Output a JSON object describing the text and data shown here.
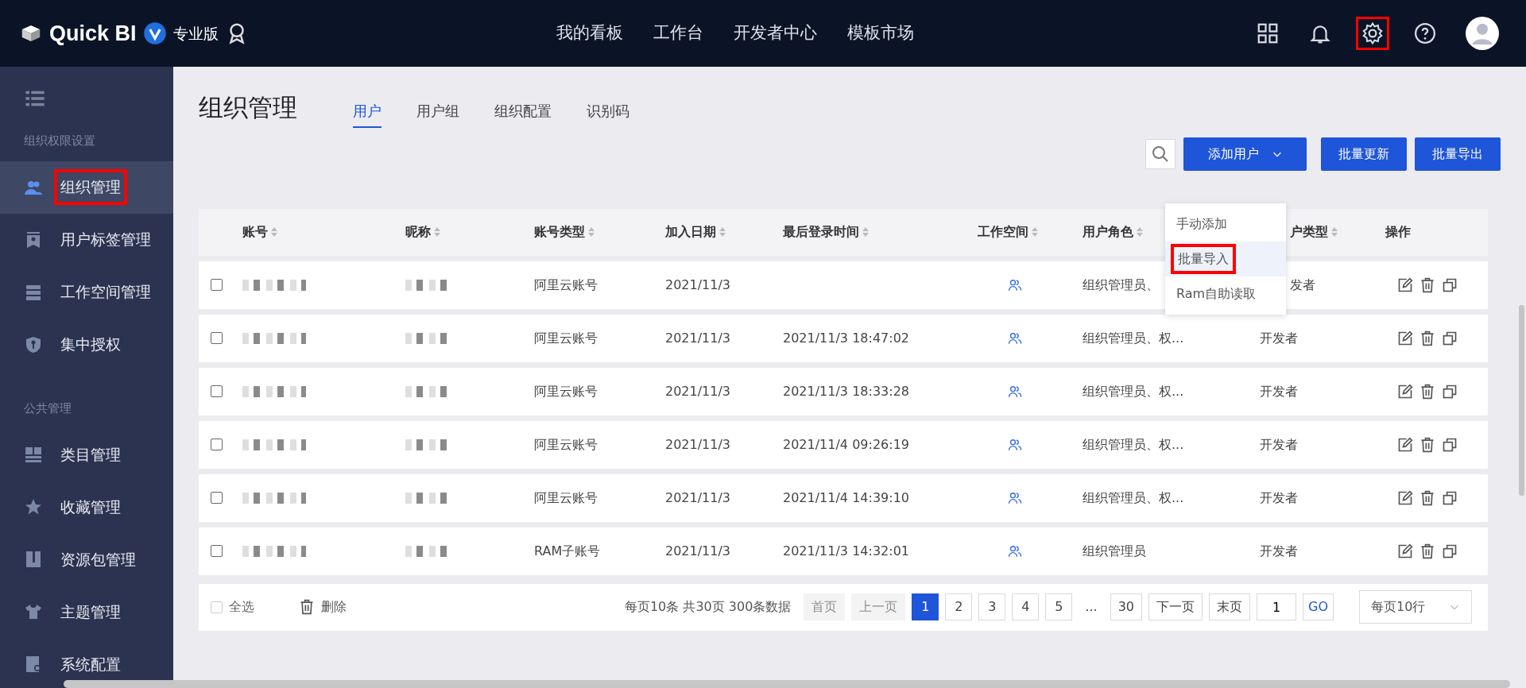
{
  "topbar": {
    "logo": "Quick BI",
    "edition": "专业版",
    "nav": [
      "我的看板",
      "工作台",
      "开发者中心",
      "模板市场"
    ],
    "icons": [
      {
        "kind": "grid",
        "highlighted": false
      },
      {
        "kind": "bell",
        "highlighted": false
      },
      {
        "kind": "settings",
        "highlighted": true
      },
      {
        "kind": "help",
        "highlighted": false
      },
      {
        "kind": "avatar",
        "highlighted": false
      }
    ]
  },
  "sidebar": {
    "sections": [
      {
        "title": "组织权限设置",
        "items": [
          {
            "label": "组织管理",
            "kind": "users",
            "selected": true,
            "highlighted": true
          },
          {
            "label": "用户标签管理",
            "kind": "badge",
            "selected": false,
            "highlighted": false
          },
          {
            "label": "工作空间管理",
            "kind": "cabinet",
            "selected": false,
            "highlighted": false
          },
          {
            "label": "集中授权",
            "kind": "shield",
            "selected": false,
            "highlighted": false
          }
        ]
      },
      {
        "title": "公共管理",
        "items": [
          {
            "label": "类目管理",
            "kind": "blocks",
            "selected": false,
            "highlighted": false
          },
          {
            "label": "收藏管理",
            "kind": "star",
            "selected": false,
            "highlighted": false
          },
          {
            "label": "资源包管理",
            "kind": "package",
            "selected": false,
            "highlighted": false
          },
          {
            "label": "主题管理",
            "kind": "shirt",
            "selected": false,
            "highlighted": false
          },
          {
            "label": "系统配置",
            "kind": "config",
            "selected": false,
            "highlighted": false
          }
        ]
      }
    ]
  },
  "page": {
    "title": "组织管理",
    "tabs": [
      {
        "label": "用户",
        "selected": true
      },
      {
        "label": "用户组",
        "selected": false
      },
      {
        "label": "组织配置",
        "selected": false
      },
      {
        "label": "识别码",
        "selected": false
      }
    ]
  },
  "toolbar": {
    "buttons": [
      {
        "label": "添加用户",
        "kind": "dropdown"
      },
      {
        "label": "批量更新",
        "kind": "plain"
      },
      {
        "label": "批量导出",
        "kind": "plain"
      }
    ]
  },
  "dropdown": {
    "items": [
      {
        "label": "手动添加",
        "hovered": false,
        "highlighted": false
      },
      {
        "label": "批量导入",
        "hovered": true,
        "highlighted": true
      },
      {
        "label": "Ram自助读取",
        "hovered": false,
        "highlighted": false
      }
    ]
  },
  "table": {
    "columns": [
      {
        "label": "账号",
        "sortable": true
      },
      {
        "label": "昵称",
        "sortable": true
      },
      {
        "label": "账号类型",
        "sortable": true
      },
      {
        "label": "加入日期",
        "sortable": true
      },
      {
        "label": "最后登录时间",
        "sortable": true
      },
      {
        "label": "工作空间",
        "sortable": true
      },
      {
        "label": "用户角色",
        "sortable": true
      },
      {
        "label": "户类型",
        "sortable": true
      },
      {
        "label": "操作",
        "sortable": false
      }
    ],
    "rows": [
      {
        "checked": false,
        "account_type": "阿里云账号",
        "join_date": "2021/11/3",
        "role": "组织管理员、",
        "user_type": "发者"
      },
      {
        "checked": false,
        "account_type": "阿里云账号",
        "join_date": "2021/11/3",
        "last_login": "2021/11/3 18:47:02",
        "role": "组织管理员、权...",
        "user_type": "开发者"
      },
      {
        "checked": false,
        "account_type": "阿里云账号",
        "join_date": "2021/11/3",
        "last_login": "2021/11/3 18:33:28",
        "role": "组织管理员、权...",
        "user_type": "开发者"
      },
      {
        "checked": false,
        "account_type": "阿里云账号",
        "join_date": "2021/11/3",
        "last_login": "2021/11/4 09:26:19",
        "role": "组织管理员、权...",
        "user_type": "开发者"
      },
      {
        "checked": false,
        "account_type": "阿里云账号",
        "join_date": "2021/11/3",
        "last_login": "2021/11/4 14:39:10",
        "role": "组织管理员、权...",
        "user_type": "开发者"
      },
      {
        "checked": false,
        "account_type": "RAM子账号",
        "join_date": "2021/11/3",
        "last_login": "2021/11/3 14:32:01",
        "role": "组织管理员",
        "user_type": "开发者"
      }
    ]
  },
  "footer": {
    "select_all": {
      "label": "全选",
      "checked": false
    },
    "delete": "删除",
    "summary": "每页10条 共30页 300条数据",
    "pages": [
      {
        "label": "首页",
        "kind": "nav",
        "disabled": true,
        "selected": false
      },
      {
        "label": "上一页",
        "kind": "nav",
        "disabled": true,
        "selected": false
      },
      {
        "label": "1",
        "kind": "page",
        "disabled": false,
        "selected": true
      },
      {
        "label": "2",
        "kind": "page",
        "disabled": false,
        "selected": false
      },
      {
        "label": "3",
        "kind": "page",
        "disabled": false,
        "selected": false
      },
      {
        "label": "4",
        "kind": "page",
        "disabled": false,
        "selected": false
      },
      {
        "label": "5",
        "kind": "page",
        "disabled": false,
        "selected": false
      },
      {
        "label": "...",
        "kind": "ellipsis",
        "disabled": false,
        "selected": false
      },
      {
        "label": "30",
        "kind": "page",
        "disabled": false,
        "selected": false
      },
      {
        "label": "下一页",
        "kind": "nav",
        "disabled": false,
        "selected": false
      },
      {
        "label": "末页",
        "kind": "nav",
        "disabled": false,
        "selected": false
      }
    ],
    "jump_value": "1",
    "go": "GO",
    "page_size": "每页10行"
  }
}
